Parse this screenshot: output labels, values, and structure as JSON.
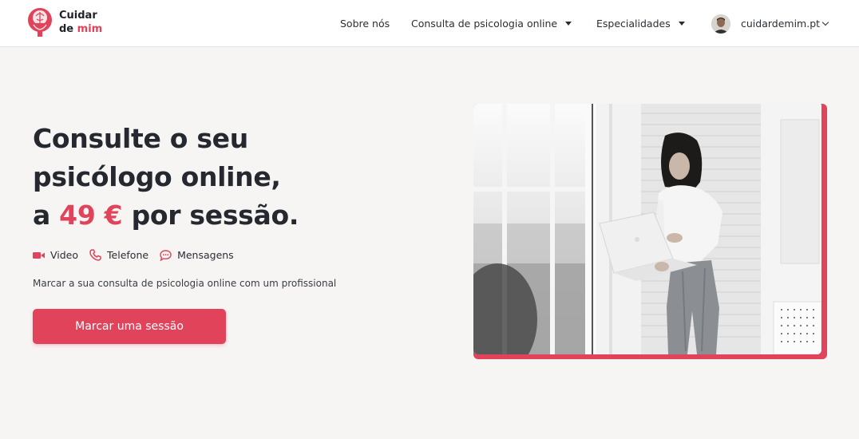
{
  "brand": {
    "line1": "Cuidar",
    "line2_a": "de",
    "line2_b": "mim",
    "accent_color": "#e0435a"
  },
  "nav": {
    "about": "Sobre nós",
    "consult": "Consulta de psicologia online",
    "specialties": "Especialidades",
    "account": "cuidardemim.pt"
  },
  "hero": {
    "title_line1": "Consulte o seu",
    "title_line2": "psicólogo online,",
    "title_line3_a": "a",
    "title_line3_price": "49 €",
    "title_line3_b": "por sessão.",
    "channels": [
      {
        "icon": "video-camera-icon",
        "label": "Video"
      },
      {
        "icon": "phone-icon",
        "label": "Telefone"
      },
      {
        "icon": "chat-bubble-icon",
        "label": "Mensagens"
      }
    ],
    "subtitle": "Marcar a sua consulta de psicologia online com um profissional",
    "cta": "Marcar uma sessão"
  }
}
